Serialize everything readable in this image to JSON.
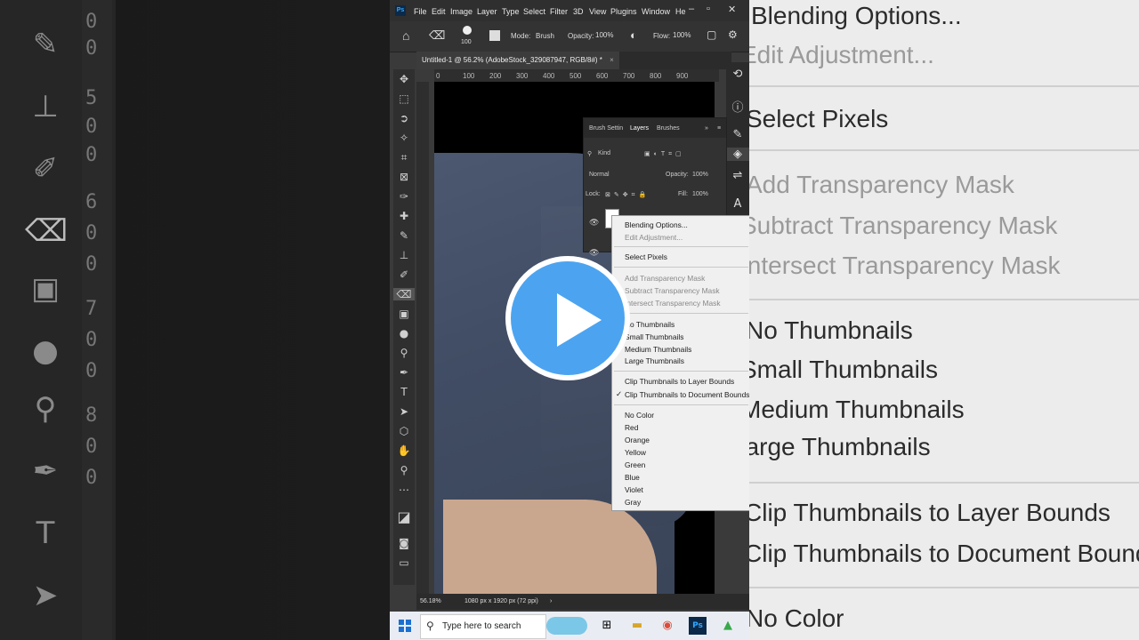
{
  "menubar": {
    "app_icon": "Ps",
    "items": [
      "File",
      "Edit",
      "Image",
      "Layer",
      "Type",
      "Select",
      "Filter",
      "3D",
      "View",
      "Plugins",
      "Window",
      "He"
    ]
  },
  "options_bar": {
    "brush_size": "100",
    "mode_label": "Mode:",
    "mode_value": "Brush",
    "opacity_label": "Opacity:",
    "opacity_value": "100%",
    "flow_label": "Flow:",
    "flow_value": "100%"
  },
  "document": {
    "tab_title": "Untitled-1 @ 56.2% (AdobeStock_329087947, RGB/8#) *",
    "ruler_h": [
      "0",
      "100",
      "200",
      "300",
      "400",
      "500",
      "600",
      "700",
      "800",
      "900"
    ],
    "zoom": "56.18%",
    "doc_info": "1080 px x 1920 px (72 ppi)"
  },
  "layers_panel": {
    "tabs": [
      "Brush Settin",
      "Layers",
      "Brushes"
    ],
    "filter_kind": "Kind",
    "blend_mode": "Normal",
    "opacity_label": "Opacity:",
    "opacity_value": "100%",
    "lock_label": "Lock:",
    "fill_label": "Fill:",
    "fill_value": "100%"
  },
  "context_menu": {
    "items": [
      {
        "label": "Blending Options...",
        "enabled": true
      },
      {
        "label": "Edit Adjustment...",
        "enabled": false
      },
      {
        "label": "Select Pixels",
        "enabled": true
      },
      {
        "label": "Add Transparency Mask",
        "enabled": false
      },
      {
        "label": "Subtract Transparency Mask",
        "enabled": false
      },
      {
        "label": "Intersect Transparency Mask",
        "enabled": false
      },
      {
        "label": "No Thumbnails",
        "enabled": true
      },
      {
        "label": "Small Thumbnails",
        "enabled": true
      },
      {
        "label": "Medium Thumbnails",
        "enabled": true
      },
      {
        "label": "Large Thumbnails",
        "enabled": true
      },
      {
        "label": "Clip Thumbnails to Layer Bounds",
        "enabled": true
      },
      {
        "label": "Clip Thumbnails to Document Bounds",
        "enabled": true,
        "checked": true
      },
      {
        "label": "No Color",
        "enabled": true
      },
      {
        "label": "Red",
        "enabled": true
      },
      {
        "label": "Orange",
        "enabled": true
      },
      {
        "label": "Yellow",
        "enabled": true
      },
      {
        "label": "Green",
        "enabled": true
      },
      {
        "label": "Blue",
        "enabled": true
      },
      {
        "label": "Violet",
        "enabled": true
      },
      {
        "label": "Gray",
        "enabled": true
      }
    ]
  },
  "taskbar": {
    "search_placeholder": "Type here to search"
  },
  "background_zoom": {
    "items": [
      "Blending Options...",
      "Edit Adjustment...",
      "Select Pixels",
      "Add Transparency Mask",
      "Subtract Transparency Mask",
      "Intersect Transparency Mask",
      "No Thumbnails",
      "Small Thumbnails",
      "Medium Thumbnails",
      "Large Thumbnails",
      "Clip Thumbnails to Layer Bounds",
      "Clip Thumbnails to Document Bounds",
      "No Color"
    ],
    "ruler_digits": [
      "0",
      "0",
      "5",
      "0",
      "0",
      "6",
      "0",
      "0",
      "7",
      "0",
      "0",
      "8",
      "0",
      "0"
    ]
  },
  "colors": {
    "accent_play": "#4ca4f0",
    "ps_bg": "#3a3a3a",
    "menu_bg": "#f0f0f0"
  },
  "icons": [
    "play-icon",
    "home-icon",
    "eraser-icon",
    "move-icon",
    "marquee-icon",
    "lasso-icon",
    "crop-icon",
    "eyedropper-icon",
    "brush-icon",
    "stamp-icon",
    "gradient-icon",
    "text-icon",
    "hand-icon",
    "zoom-icon",
    "windows-icon",
    "search-icon",
    "eye-icon",
    "photoshop-icon",
    "chrome-icon"
  ]
}
